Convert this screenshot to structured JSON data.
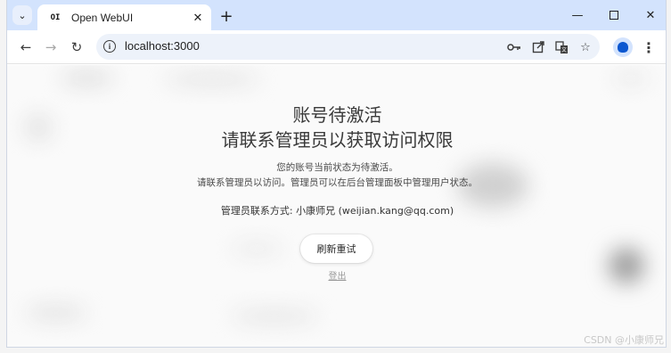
{
  "browser": {
    "tab_title": "Open WebUI",
    "tab_favicon": "OI",
    "url": "localhost:3000"
  },
  "icons": {
    "tab_search": "chevron-down-icon",
    "tab_close": "close-icon",
    "new_tab": "plus-icon",
    "minimize": "minimize-icon",
    "maximize": "maximize-icon",
    "window_close": "close-icon",
    "back": "back-arrow-icon",
    "forward": "forward-arrow-icon",
    "reload": "reload-icon",
    "site_info": "info-icon",
    "password": "key-icon",
    "open_in_app": "external-link-icon",
    "translate": "translate-icon",
    "bookmark": "star-icon",
    "profile": "profile-icon",
    "menu": "kebab-menu-icon"
  },
  "page": {
    "title_line1": "账号待激活",
    "title_line2": "请联系管理员以获取访问权限",
    "desc_line1": "您的账号当前状态为待激活。",
    "desc_line2": "请联系管理员以访问。管理员可以在后台管理面板中管理用户状态。",
    "contact": "管理员联系方式: 小康师兄 (weijian.kang@qq.com)",
    "retry_button": "刷新重试",
    "logout_link": "登出"
  },
  "watermark": "CSDN @小康师兄",
  "colors": {
    "tabstrip": "#d3e3fd",
    "omnibox": "#edf2fa",
    "accent": "#0b57d0"
  }
}
